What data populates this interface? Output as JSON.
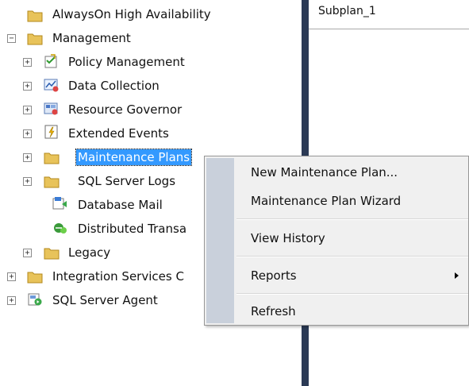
{
  "tree": {
    "items": [
      {
        "label": "AlwaysOn High Availability",
        "icon": "folder-icon"
      },
      {
        "label": "Management",
        "icon": "folder-icon",
        "expander": "−"
      },
      {
        "label": "Policy Management",
        "icon": "policy-icon",
        "expander": "+"
      },
      {
        "label": "Data Collection",
        "icon": "data-collection-icon",
        "expander": "+"
      },
      {
        "label": "Resource Governor",
        "icon": "resource-governor-icon",
        "expander": "+"
      },
      {
        "label": "Extended Events",
        "icon": "extended-events-icon",
        "expander": "+"
      },
      {
        "label": "Maintenance Plans",
        "icon": "folder-icon",
        "expander": "+",
        "selected": true
      },
      {
        "label": "SQL Server Logs",
        "icon": "folder-icon",
        "expander": "+"
      },
      {
        "label": "Database Mail",
        "icon": "database-mail-icon"
      },
      {
        "label": "Distributed Transa",
        "icon": "distributed-transaction-icon"
      },
      {
        "label": "Legacy",
        "icon": "folder-icon",
        "expander": "+"
      },
      {
        "label": "Integration Services C",
        "icon": "folder-icon",
        "expander": "+"
      },
      {
        "label": "SQL Server Agent",
        "icon": "sql-agent-icon",
        "expander": "+"
      }
    ]
  },
  "right_pane": {
    "subplan_label": "Subplan_1"
  },
  "context_menu": {
    "items": [
      {
        "label": "New Maintenance Plan..."
      },
      {
        "label": "Maintenance Plan Wizard"
      },
      {
        "label": "View History"
      },
      {
        "label": "Reports",
        "submenu": true
      },
      {
        "label": "Refresh"
      }
    ]
  },
  "colors": {
    "selection": "#3399ff",
    "divider": "#2b3a55",
    "menu_background": "#f0f0f0",
    "menu_gutter": "#c9d0db",
    "folder": "#e8c35a"
  }
}
